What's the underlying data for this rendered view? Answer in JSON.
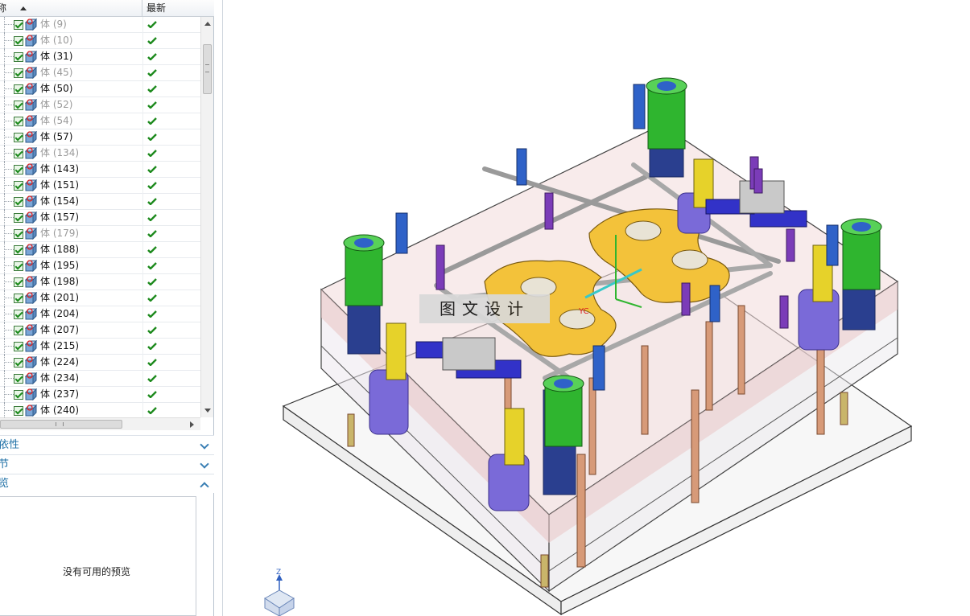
{
  "tree": {
    "header": {
      "name_label": "称",
      "latest_label": "最新"
    },
    "rows": [
      {
        "label": "体 (9)",
        "dim": true
      },
      {
        "label": "体 (10)",
        "dim": true
      },
      {
        "label": "体 (31)",
        "dim": false
      },
      {
        "label": "体 (45)",
        "dim": true
      },
      {
        "label": "体 (50)",
        "dim": false
      },
      {
        "label": "体 (52)",
        "dim": true
      },
      {
        "label": "体 (54)",
        "dim": true
      },
      {
        "label": "体 (57)",
        "dim": false
      },
      {
        "label": "体 (134)",
        "dim": true
      },
      {
        "label": "体 (143)",
        "dim": false
      },
      {
        "label": "体 (151)",
        "dim": false
      },
      {
        "label": "体 (154)",
        "dim": false
      },
      {
        "label": "体 (157)",
        "dim": false
      },
      {
        "label": "体 (179)",
        "dim": true
      },
      {
        "label": "体 (188)",
        "dim": false
      },
      {
        "label": "体 (195)",
        "dim": false
      },
      {
        "label": "体 (198)",
        "dim": false
      },
      {
        "label": "体 (201)",
        "dim": false
      },
      {
        "label": "体 (204)",
        "dim": false
      },
      {
        "label": "体 (207)",
        "dim": false
      },
      {
        "label": "体 (215)",
        "dim": false
      },
      {
        "label": "体 (224)",
        "dim": false
      },
      {
        "label": "体 (234)",
        "dim": false
      },
      {
        "label": "体 (237)",
        "dim": false
      },
      {
        "label": "体 (240)",
        "dim": false
      }
    ]
  },
  "sections": {
    "dependency": "依性",
    "details": "节",
    "preview": "览"
  },
  "preview": {
    "message": "没有可用的预览"
  },
  "viewport": {
    "watermark": "图文设计",
    "csys_label": "YC",
    "triad_label": "Z"
  },
  "colors": {
    "accent": "#1d6fa5",
    "check_green": "#1d8a1d",
    "plate_tint": "#e9c7c7",
    "cavity_gold": "#f3c23a",
    "leader_green": "#2fb52f",
    "bushing_blue": "#2f62c8"
  }
}
